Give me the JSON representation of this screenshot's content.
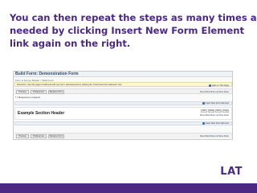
{
  "slide": {
    "lines": [
      "You can then repeat the steps as many times as",
      "needed by clicking Insert New Form Element",
      "link again on the right."
    ],
    "logo": "LAT",
    "accent_color": "#4b2882"
  },
  "screenshot": {
    "title": "Build Form: Demonstration Form",
    "breadcrumb": "Form & Survey Builder > Build Form",
    "directions": "Directions: Use this page to build and edit your form. Add elements by clicking the \"Insert New Form Element\" link.",
    "help_link": "Help on This Page",
    "toolbar": [
      "Preview",
      "Preferences",
      "Rename Form"
    ],
    "required_note_marker": "*",
    "required_note": " = Response is required",
    "insert_link": "Insert New Form Element",
    "section_header": "Example Section Header",
    "section_buttons": [
      "Edit",
      "Delete",
      "Save",
      "Copy"
    ],
    "move_links": "Move Block Move Up Move Down"
  }
}
